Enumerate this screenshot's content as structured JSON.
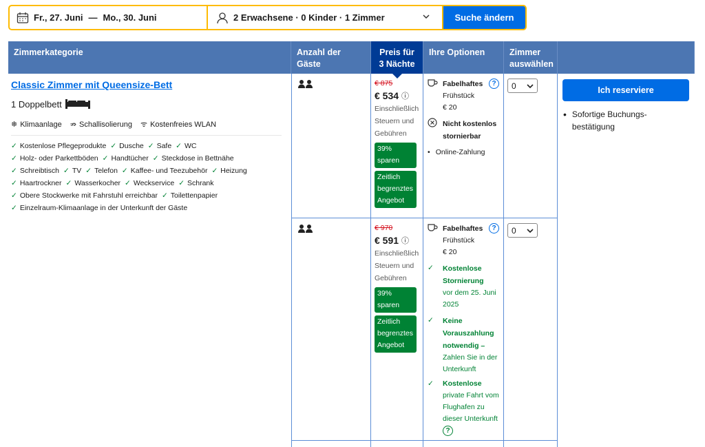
{
  "search": {
    "date_from": "Fr., 27. Juni",
    "date_sep": "—",
    "date_to": "Mo., 30. Juni",
    "guests": "2 Erwachsene · 0 Kinder · 1 Zimmer",
    "button": "Suche ändern"
  },
  "table": {
    "headers": {
      "category": "Zimmerkategorie",
      "guests": "Anzahl der Gäste",
      "price": "Preis für 3 Nächte",
      "options": "Ihre Optionen",
      "rooms": "Zimmer auswählen"
    }
  },
  "room": {
    "title": "Classic Zimmer mit Queensize-Bett",
    "bed": "1 Doppelbett",
    "facilities": [
      "Klimaanlage",
      "Schallisolierung",
      "Kostenfreies WLAN"
    ],
    "amenities": [
      "Kostenlose Pflegeprodukte",
      "Dusche",
      "Safe",
      "WC",
      "Holz- oder Parkettböden",
      "Handtücher",
      "Steckdose in Bettnähe",
      "Schreibtisch",
      "TV",
      "Telefon",
      "Kaffee- und Teezubehör",
      "Heizung",
      "Haartrockner",
      "Wasserkocher",
      "Weckservice",
      "Schrank",
      "Obere Stockwerke mit Fahrstuhl erreichbar",
      "Toilettenpapier",
      "Einzelraum-Klimaanlage in der Unterkunft der Gäste"
    ]
  },
  "offers": [
    {
      "old_price": "€ 875",
      "price": "€ 534",
      "tax_note": "Einschließlich Steuern und Gebühren",
      "badge_save": "39% sparen",
      "badge_deal": "Zeitlich begrenztes Angebot",
      "breakfast_title": "Fabelhaftes",
      "breakfast_sub": "Frühstück",
      "breakfast_price": "€ 20",
      "cancel": "Nicht kostenlos stornierbar",
      "payment": "Online-Zahlung",
      "select_value": "0"
    },
    {
      "old_price": "€ 970",
      "price": "€ 591",
      "tax_note": "Einschließlich Steuern und Gebühren",
      "badge_save": "39% sparen",
      "badge_deal": "Zeitlich begrenztes Angebot",
      "breakfast_title": "Fabelhaftes",
      "breakfast_sub": "Frühstück",
      "breakfast_price": "€ 20",
      "cancel_title": "Kostenlose Stornierung",
      "cancel_sub": "vor dem 25. Juni 2025",
      "prepay_title": "Keine Vorauszahlung notwendig –",
      "prepay_sub": "Zahlen Sie in der Unterkunft",
      "transfer_title": "Kostenlose",
      "transfer_sub": "private Fahrt vom Flughafen zu dieser Unterkunft",
      "select_value": "0"
    }
  ],
  "reserve": {
    "button": "Ich reserviere",
    "note": "Sofortige Buchungs-bestätigung"
  },
  "colors": {
    "brand": "#006ce4",
    "header": "#4c76b2",
    "active_header": "#003b95",
    "accent": "#febb02",
    "green": "#008234"
  }
}
